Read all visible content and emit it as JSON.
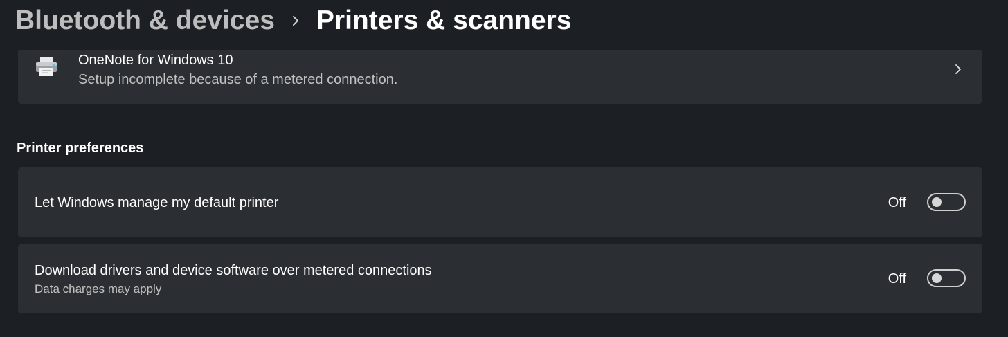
{
  "breadcrumb": {
    "parent": "Bluetooth & devices",
    "separator_icon": "chevron-right-icon",
    "current": "Printers & scanners"
  },
  "onenote_card": {
    "icon": "printer-icon",
    "title": "OneNote for Windows 10",
    "subtitle": "Setup incomplete because of a metered connection.",
    "chevron_icon": "chevron-right-icon"
  },
  "printer_preferences": {
    "section_title": "Printer preferences",
    "items": [
      {
        "label": "Let Windows manage my default printer",
        "sublabel": "",
        "state_label": "Off",
        "is_on": false
      },
      {
        "label": "Download drivers and device software over metered connections",
        "sublabel": "Data charges may apply",
        "state_label": "Off",
        "is_on": false
      }
    ]
  },
  "colors": {
    "background": "#1c2024",
    "card": "#2b2e32",
    "text_primary": "#ffffff",
    "text_secondary": "#c2c2c2",
    "breadcrumb_parent": "#bdbdbd"
  }
}
